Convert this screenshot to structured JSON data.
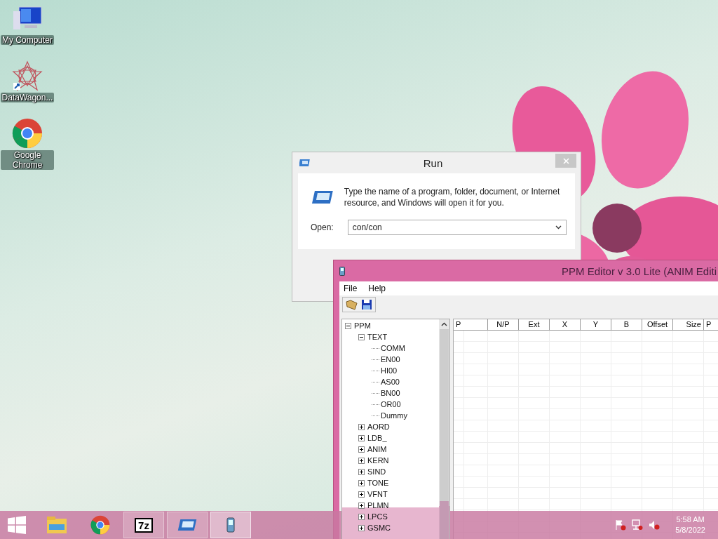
{
  "desktop_icons": [
    {
      "kind": "computer",
      "label": "My Computer"
    },
    {
      "kind": "datawagon",
      "label": "DataWagon..."
    },
    {
      "kind": "chrome",
      "label": "Google Chrome"
    }
  ],
  "run_dialog": {
    "title": "Run",
    "message": "Type the name of a program, folder, document, or Internet resource, and Windows will open it for you.",
    "open_label": "Open:",
    "open_value": "con/con"
  },
  "ppm_window": {
    "title": "PPM Editor v 3.0 Lite (ANIM Editi",
    "menu": [
      "File",
      "Help"
    ],
    "tree": [
      {
        "label": "PPM",
        "expanded": true,
        "children": [
          {
            "label": "TEXT",
            "expanded": true,
            "children": [
              {
                "label": "COMM"
              },
              {
                "label": "EN00"
              },
              {
                "label": "HI00"
              },
              {
                "label": "AS00"
              },
              {
                "label": "BN00"
              },
              {
                "label": "OR00"
              },
              {
                "label": "Dummy"
              }
            ]
          },
          {
            "label": "AORD",
            "expanded": false
          },
          {
            "label": "LDB_",
            "expanded": false
          },
          {
            "label": "ANIM",
            "expanded": false
          },
          {
            "label": "KERN",
            "expanded": false
          },
          {
            "label": "SIND",
            "expanded": false
          },
          {
            "label": "TONE",
            "expanded": false
          },
          {
            "label": "VFNT",
            "expanded": false
          },
          {
            "label": "PLMN",
            "expanded": false
          },
          {
            "label": "LPCS",
            "expanded": false
          },
          {
            "label": "GSMC",
            "expanded": false
          }
        ]
      }
    ],
    "columns": [
      "P",
      "N/P",
      "Ext",
      "X",
      "Y",
      "B",
      "Offset",
      "Size",
      "P"
    ]
  },
  "taskbar": {
    "apps": [
      {
        "kind": "explorer",
        "running": false,
        "selected": false
      },
      {
        "kind": "chrome",
        "running": false,
        "selected": false
      },
      {
        "kind": "archiver",
        "label": "7z",
        "running": true,
        "selected": false
      },
      {
        "kind": "run",
        "running": true,
        "selected": false
      },
      {
        "kind": "ppm",
        "running": true,
        "selected": true
      }
    ],
    "time": "5:58 AM",
    "date": "5/8/2022"
  }
}
